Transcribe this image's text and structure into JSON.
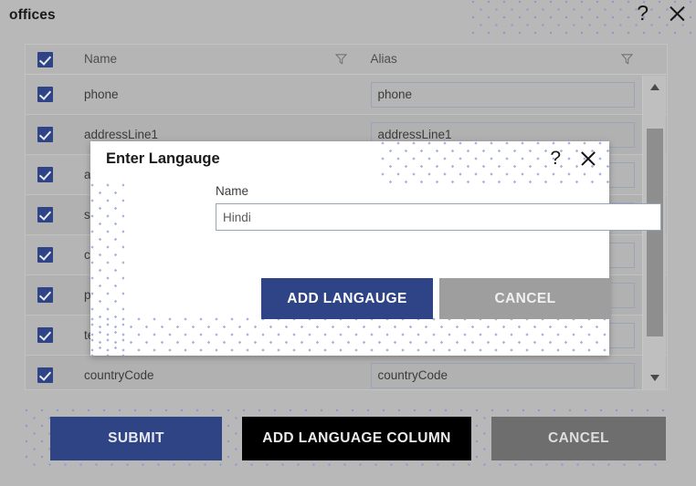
{
  "header": {
    "title": "offices",
    "help_icon": "question-mark-icon",
    "close_icon": "close-icon"
  },
  "table": {
    "columns": [
      {
        "key": "name",
        "label": "Name",
        "filter_icon": "filter-icon"
      },
      {
        "key": "alias",
        "label": "Alias",
        "filter_icon": "filter-icon"
      }
    ],
    "rows": [
      {
        "checked": true,
        "name": "phone",
        "alias": "phone"
      },
      {
        "checked": true,
        "name": "addressLine1",
        "alias": "addressLine1"
      },
      {
        "checked": true,
        "name": "a",
        "alias": ""
      },
      {
        "checked": true,
        "name": "s",
        "alias": ""
      },
      {
        "checked": true,
        "name": "c",
        "alias": ""
      },
      {
        "checked": true,
        "name": "p",
        "alias": ""
      },
      {
        "checked": true,
        "name": "te",
        "alias": ""
      },
      {
        "checked": true,
        "name": "countryCode",
        "alias": "countryCode"
      }
    ],
    "header_checkbox_checked": true,
    "scrollbar": {
      "up_arrow_icon": "triangle-up-icon",
      "down_arrow_icon": "triangle-down-icon"
    }
  },
  "actions": {
    "submit_label": "SUBMIT",
    "add_language_column_label": "ADD LANGUAGE COLUMN",
    "cancel_label": "CANCEL"
  },
  "modal": {
    "title": "Enter Langauge",
    "help_icon": "question-mark-icon",
    "close_icon": "close-icon",
    "field_label": "Name",
    "field_value": "Hindi",
    "field_placeholder": "",
    "add_label": "ADD LANGAUGE",
    "cancel_label": "CANCEL"
  },
  "colors": {
    "primary": "#2f4486",
    "black_button": "#000000",
    "gray_button": "#6e6e6e",
    "modal_cancel": "#9e9e9e",
    "page_background": "#b8b8b8",
    "dot_pattern": "#8e9ac9"
  }
}
